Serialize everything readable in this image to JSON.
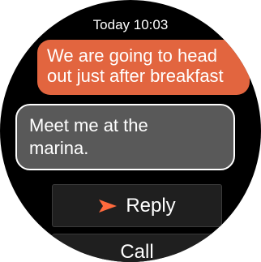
{
  "header": {
    "timestamp": "Today 10:03"
  },
  "conversation": {
    "incoming_message": "We are going to head\nout just after breakfast",
    "outgoing_message": "Meet me at the\nmarina."
  },
  "actions": {
    "reply_label": "Reply",
    "call_label": "Call",
    "reply_icon": "send-arrow-icon"
  },
  "colors": {
    "incoming_bubble": "#e2653f",
    "outgoing_bubble": "#595959",
    "accent": "#ff6a3d",
    "background": "#000000"
  }
}
